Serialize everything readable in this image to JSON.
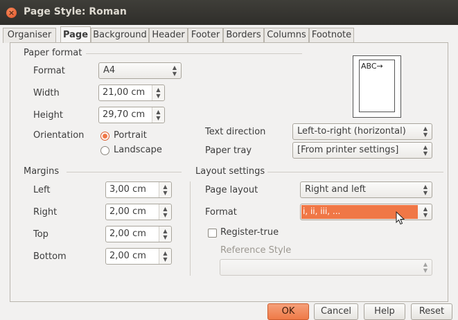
{
  "window": {
    "title": "Page Style: Roman"
  },
  "tabs": [
    "Organiser",
    "Page",
    "Background",
    "Header",
    "Footer",
    "Borders",
    "Columns",
    "Footnote"
  ],
  "paper_format": {
    "section_label": "Paper format",
    "format_label": "Format",
    "format_value": "A4",
    "width_label": "Width",
    "width_value": "21,00 cm",
    "height_label": "Height",
    "height_value": "29,70 cm",
    "orientation_label": "Orientation",
    "portrait_label": "Portrait",
    "landscape_label": "Landscape",
    "orientation_selected": "Portrait",
    "text_direction_label": "Text direction",
    "text_direction_value": "Left-to-right (horizontal)",
    "paper_tray_label": "Paper tray",
    "paper_tray_value": "[From printer settings]"
  },
  "preview": {
    "text": "ABC→"
  },
  "margins": {
    "section_label": "Margins",
    "left_label": "Left",
    "left_value": "3,00 cm",
    "right_label": "Right",
    "right_value": "2,00 cm",
    "top_label": "Top",
    "top_value": "2,00 cm",
    "bottom_label": "Bottom",
    "bottom_value": "2,00 cm"
  },
  "layout": {
    "section_label": "Layout settings",
    "page_layout_label": "Page layout",
    "page_layout_value": "Right and left",
    "format_label": "Format",
    "format_value": "i, ii, iii, ...",
    "register_true_label": "Register-true",
    "reference_style_label": "Reference Style",
    "reference_style_value": ""
  },
  "buttons": {
    "ok": "OK",
    "cancel": "Cancel",
    "help": "Help",
    "reset": "Reset"
  },
  "colors": {
    "accent": "#f07746",
    "titlebar": "#3c3b37"
  },
  "icons": {
    "close": "close-icon",
    "cursor": "mouse-pointer-icon"
  }
}
